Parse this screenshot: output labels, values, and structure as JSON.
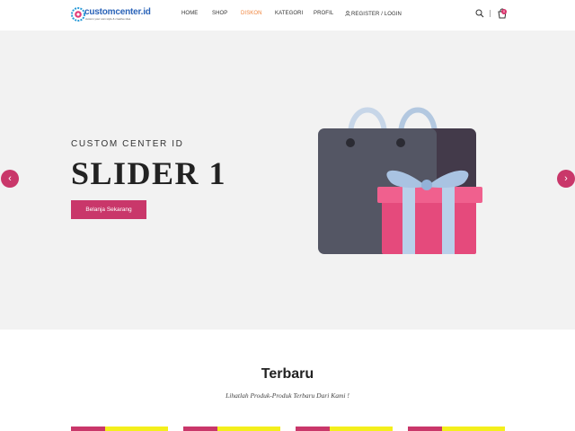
{
  "brand": {
    "name": "customcenter.id",
    "tagline": "custom your own style & creative idea"
  },
  "nav": {
    "items": [
      {
        "label": "HOME",
        "active": false
      },
      {
        "label": "SHOP",
        "active": false
      },
      {
        "label": "DISKON",
        "active": true
      },
      {
        "label": "KATEGORI",
        "active": false
      },
      {
        "label": "PROFIL",
        "active": false
      },
      {
        "label": "REGISTER / LOGIN",
        "active": false
      }
    ],
    "cart_count": "0"
  },
  "hero": {
    "subtitle": "CUSTOM CENTER ID",
    "title": "SLIDER 1",
    "button": "Belanja Sekarang",
    "prev_arrow": "‹",
    "next_arrow": "›"
  },
  "section": {
    "title": "Terbaru",
    "subtitle": "Lihatlah Produk-Produk Terbaru Dari Kami !"
  },
  "colors": {
    "accent": "#c9376a",
    "active_nav": "#f0843c",
    "hero_bg": "#f2f2f2",
    "product_yellow": "#f4ef1c"
  },
  "icons": [
    "search-icon",
    "cart-icon",
    "user-icon",
    "chevron-left-icon",
    "chevron-right-icon"
  ]
}
